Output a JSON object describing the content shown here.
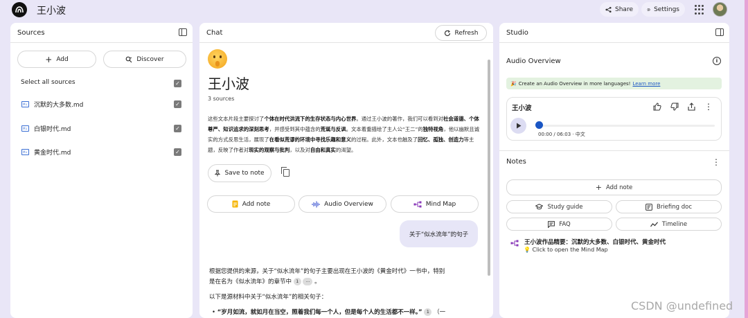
{
  "app": {
    "title": "王小波",
    "share_label": "Share",
    "settings_label": "Settings",
    "icons": {
      "logo": "notebooklm-logo-icon",
      "share": "share-icon",
      "settings": "gear-icon",
      "apps": "apps-grid-icon",
      "avatar": "user-avatar"
    }
  },
  "sources": {
    "header": "Sources",
    "add_label": "Add",
    "discover_label": "Discover",
    "select_all": "Select all sources",
    "items": [
      {
        "name": "沉默的大多数.md",
        "checked": true
      },
      {
        "name": "白银时代.md",
        "checked": true
      },
      {
        "name": "黄金时代.md",
        "checked": true
      }
    ]
  },
  "chat": {
    "header": "Chat",
    "refresh_label": "Refresh",
    "emoji": "🤫",
    "title": "王小波",
    "source_count": "3 sources",
    "summary": [
      {
        "t": "这些文本片段主要探讨了",
        "b": false
      },
      {
        "t": "个体在时代洪流下的生存状态与内心世界",
        "b": true
      },
      {
        "t": "。通过王小波的著作，我们可以看到对",
        "b": false
      },
      {
        "t": "社会道德、个体尊严、知识追求的深刻思考",
        "b": true
      },
      {
        "t": "，并感受到其中蕴含的",
        "b": false
      },
      {
        "t": "荒诞与反讽",
        "b": true
      },
      {
        "t": "。文本着重描绘了主人公“王二”的",
        "b": false
      },
      {
        "t": "独特视角",
        "b": true
      },
      {
        "t": "，他以幽默且诚实的方式反思生活，展现了",
        "b": false
      },
      {
        "t": "在看似荒谬的环境中寻找乐趣和意义",
        "b": true
      },
      {
        "t": "的过程。此外，文本也触及了",
        "b": false
      },
      {
        "t": "回忆、孤独、创造力",
        "b": true
      },
      {
        "t": "等主题，反映了作者对",
        "b": false
      },
      {
        "t": "现实的观察与批判",
        "b": true
      },
      {
        "t": "，以及对",
        "b": false
      },
      {
        "t": "自由和真实",
        "b": true
      },
      {
        "t": "的渴望。",
        "b": false
      }
    ],
    "save_to_note": "Save to note",
    "actions": {
      "add_note": "Add note",
      "audio_overview": "Audio Overview",
      "mind_map": "Mind Map"
    },
    "user_message": "关于“似水流年”的句子",
    "response": {
      "line1": "根据您提供的来源，关于“似水流年”的句子主要出现在王小波的《黄金时代》一书中，特别",
      "line2_pre": "是在名为《似水流年》的章节中",
      "cite1": "1",
      "cite_more": "...",
      "line2_post": "。",
      "line3": "以下是源材料中关于“似水流年”的相关句子：",
      "bullet": "“岁月如流，就如月在当空，照着我们每一个人，但是每个人的生活都不一样。”",
      "bullet_cite": "1",
      "bullet_tail": "（一"
    }
  },
  "studio": {
    "header": "Studio",
    "audio_overview_label": "Audio Overview",
    "banner_text": "Create an Audio Overview in more languages!",
    "banner_link": "Learn more",
    "audio_card": {
      "title": "王小波",
      "progress": 0,
      "meta": "00:00 / 06:03 · 中文"
    },
    "notes_label": "Notes",
    "add_note": "Add note",
    "buttons": {
      "study_guide": "Study guide",
      "briefing_doc": "Briefing doc",
      "faq": "FAQ",
      "timeline": "Timeline"
    },
    "mindmap_note": {
      "title": "王小波作品精要：沉默的大多数、白银时代、黄金时代",
      "sub": "Click to open the Mind Map"
    }
  },
  "watermark": "CSDN @undefined",
  "colors": {
    "background": "#e9e6f7",
    "accent_blue": "#1a56c4",
    "user_bubble": "#e7e6f7",
    "banner_green": "#e3f2e0",
    "right_border": "#e6a3d6"
  }
}
